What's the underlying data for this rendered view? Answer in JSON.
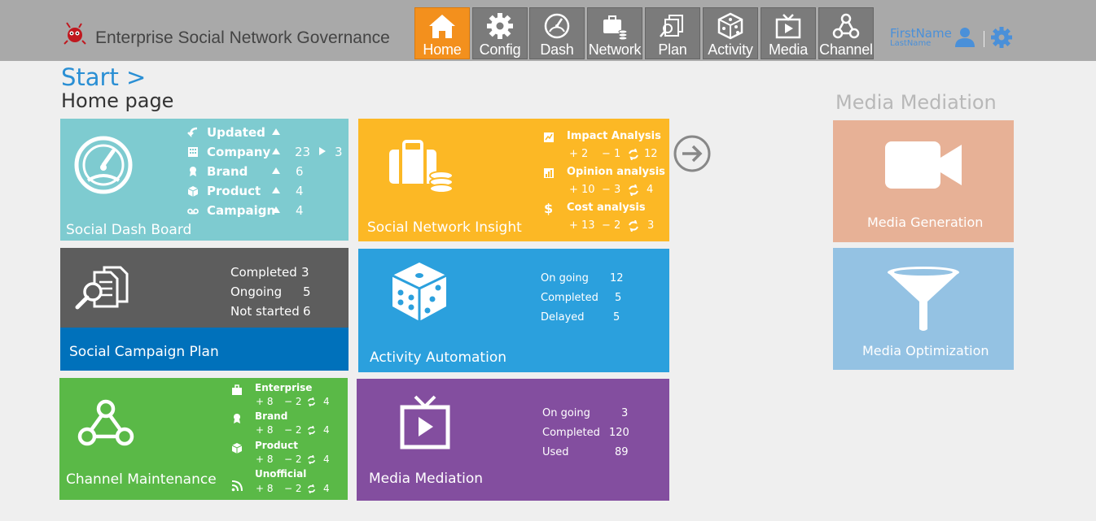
{
  "app": {
    "title": "Enterprise Social Network Governance"
  },
  "nav": [
    {
      "label": "Home",
      "icon": "home-icon"
    },
    {
      "label": "Config",
      "icon": "gear-icon"
    },
    {
      "label": "Dash",
      "icon": "dashboard-gauge-icon"
    },
    {
      "label": "Network",
      "icon": "briefcase-coins-icon"
    },
    {
      "label": "Plan",
      "icon": "documents-search-icon"
    },
    {
      "label": "Activity",
      "icon": "dice-icon"
    },
    {
      "label": "Media",
      "icon": "tv-play-icon"
    },
    {
      "label": "Channel",
      "icon": "network-nodes-icon"
    }
  ],
  "user": {
    "first": "FirstName",
    "last": "LastName"
  },
  "breadcrumb": {
    "start": "Start >",
    "page": "Home page"
  },
  "dash": {
    "title": "Social Dash Board",
    "updated": "Updated",
    "company": "Company",
    "company_a": "23",
    "company_b": "3",
    "brand": "Brand",
    "brand_v": "6",
    "product": "Product",
    "product_v": "4",
    "campaign": "Campaign",
    "campaign_v": "4"
  },
  "insight": {
    "title": "Social Network Insight",
    "impact": "Impact Analysis",
    "impact_p": "+ 2",
    "impact_m": "− 1",
    "impact_r": "12",
    "opinion": "Opinion analysis",
    "opinion_p": "+ 10",
    "opinion_m": "− 3",
    "opinion_r": "4",
    "cost": "Cost analysis",
    "cost_sym": "$",
    "cost_p": "+ 13",
    "cost_m": "− 2",
    "cost_r": "3"
  },
  "plan": {
    "title": "Social Campaign Plan",
    "completed": "Completed",
    "completed_v": "3",
    "ongoing": "Ongoing",
    "ongoing_v": "5",
    "notstarted": "Not started",
    "notstarted_v": "6"
  },
  "activity": {
    "title": "Activity Automation",
    "ongoing": "On going",
    "ongoing_v": "12",
    "completed": "Completed",
    "completed_v": "5",
    "delayed": "Delayed",
    "delayed_v": "5"
  },
  "channel": {
    "title": "Channel Maintenance",
    "rows": [
      {
        "label": "Enterprise",
        "p": "+ 8",
        "m": "− 2",
        "r": "4"
      },
      {
        "label": "Brand",
        "p": "+ 8",
        "m": "− 2",
        "r": "4"
      },
      {
        "label": "Product",
        "p": "+ 8",
        "m": "− 2",
        "r": "4"
      },
      {
        "label": "Unofficial",
        "p": "+ 8",
        "m": "− 2",
        "r": "4"
      }
    ]
  },
  "mediation": {
    "title": "Media Mediation",
    "ongoing": "On going",
    "ongoing_v": "3",
    "completed": "Completed",
    "completed_v": "120",
    "used": "Used",
    "used_v": "89"
  },
  "side": {
    "header": "Media Mediation",
    "generation": "Media Generation",
    "optimization": "Media Optimization"
  },
  "colors": {
    "dash": "#7ecbd0",
    "insight": "#fcb825",
    "plan_top": "#5d5d5d",
    "plan_bottom": "#0071bb",
    "activity": "#2ba0dd",
    "channel": "#5ab947",
    "mediation": "#834e9f",
    "generation": "#e7b196",
    "optimization": "#94c2e3",
    "nav_active": "#f3901d"
  }
}
